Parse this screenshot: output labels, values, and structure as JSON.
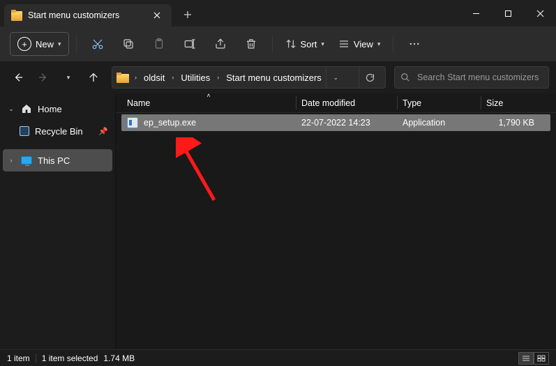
{
  "window": {
    "tab_title": "Start menu customizers"
  },
  "toolbar": {
    "new_label": "New",
    "sort_label": "Sort",
    "view_label": "View"
  },
  "breadcrumb": {
    "segments": [
      "oldsit",
      "Utilities",
      "Start menu customizers"
    ]
  },
  "search": {
    "placeholder": "Search Start menu customizers"
  },
  "sidebar": {
    "home": "Home",
    "recycle": "Recycle Bin",
    "thispc": "This PC"
  },
  "columns": {
    "name": "Name",
    "date": "Date modified",
    "type": "Type",
    "size": "Size"
  },
  "files": [
    {
      "name": "ep_setup.exe",
      "date": "22-07-2022 14:23",
      "type": "Application",
      "size": "1,790 KB"
    }
  ],
  "status": {
    "count": "1 item",
    "selected": "1 item selected",
    "size": "1.74 MB"
  }
}
